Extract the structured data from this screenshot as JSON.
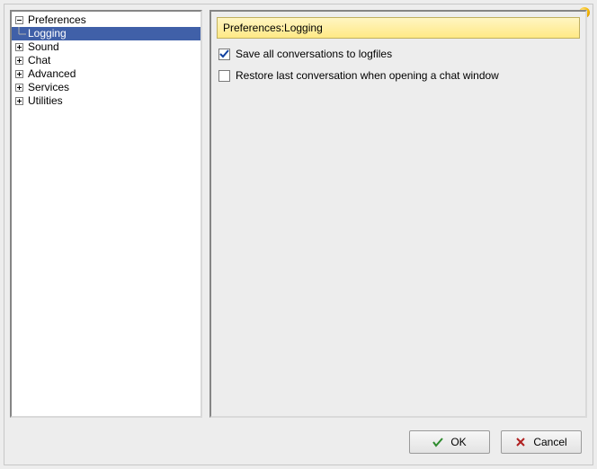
{
  "tree": {
    "root": {
      "label": "Preferences"
    },
    "selected_child": {
      "label": "Logging"
    },
    "siblings": [
      {
        "label": "Sound"
      },
      {
        "label": "Chat"
      },
      {
        "label": "Advanced"
      },
      {
        "label": "Services"
      },
      {
        "label": "Utilities"
      }
    ]
  },
  "pane": {
    "title": "Preferences:Logging",
    "options": [
      {
        "label": "Save all conversations to logfiles",
        "checked": true
      },
      {
        "label": "Restore last conversation when opening a chat window",
        "checked": false
      }
    ]
  },
  "buttons": {
    "ok": "OK",
    "cancel": "Cancel"
  }
}
